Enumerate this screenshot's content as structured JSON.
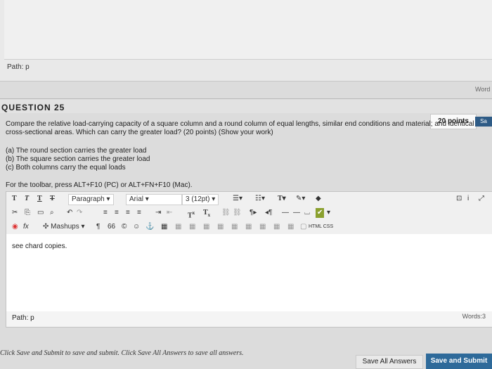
{
  "top_editor": {
    "path_label": "Path: p"
  },
  "word_count_label_top": "Word",
  "question": {
    "title": "QUESTION 25",
    "points": "20 points",
    "save_badge": "Sa",
    "text": "Compare the relative load-carrying capacity of a square column and a round column of equal lengths, similar end conditions and material; and identical cross-sectional areas. Which can carry the greater load? (20 points) (Show your work)",
    "answers": [
      "(a) The round section carries the greater load",
      "(b) The square section carries the greater load",
      "(c) Both columns carry the equal loads"
    ]
  },
  "toolbar_note": "For the toolbar, press ALT+F10 (PC) or ALT+FN+F10 (Mac).",
  "toolbar": {
    "row1": {
      "t1": "T",
      "t2": "T",
      "t3": "T",
      "t4": "T",
      "paragraph": "Paragraph",
      "font": "Arial",
      "size": "3 (12pt)"
    },
    "row2": {
      "superscript": "T",
      "subscript": "T"
    },
    "row3": {
      "mashups": "Mashups",
      "quote": "66",
      "html_css": "HTML CSS"
    }
  },
  "editor": {
    "content": "see chard copies.",
    "path_label": "Path: p",
    "words": "Words:3"
  },
  "footer": {
    "help_text": "Click Save and Submit to save and submit. Click Save All Answers to save all answers.",
    "save_all": "Save All Answers",
    "save_submit": "Save and Submit"
  }
}
